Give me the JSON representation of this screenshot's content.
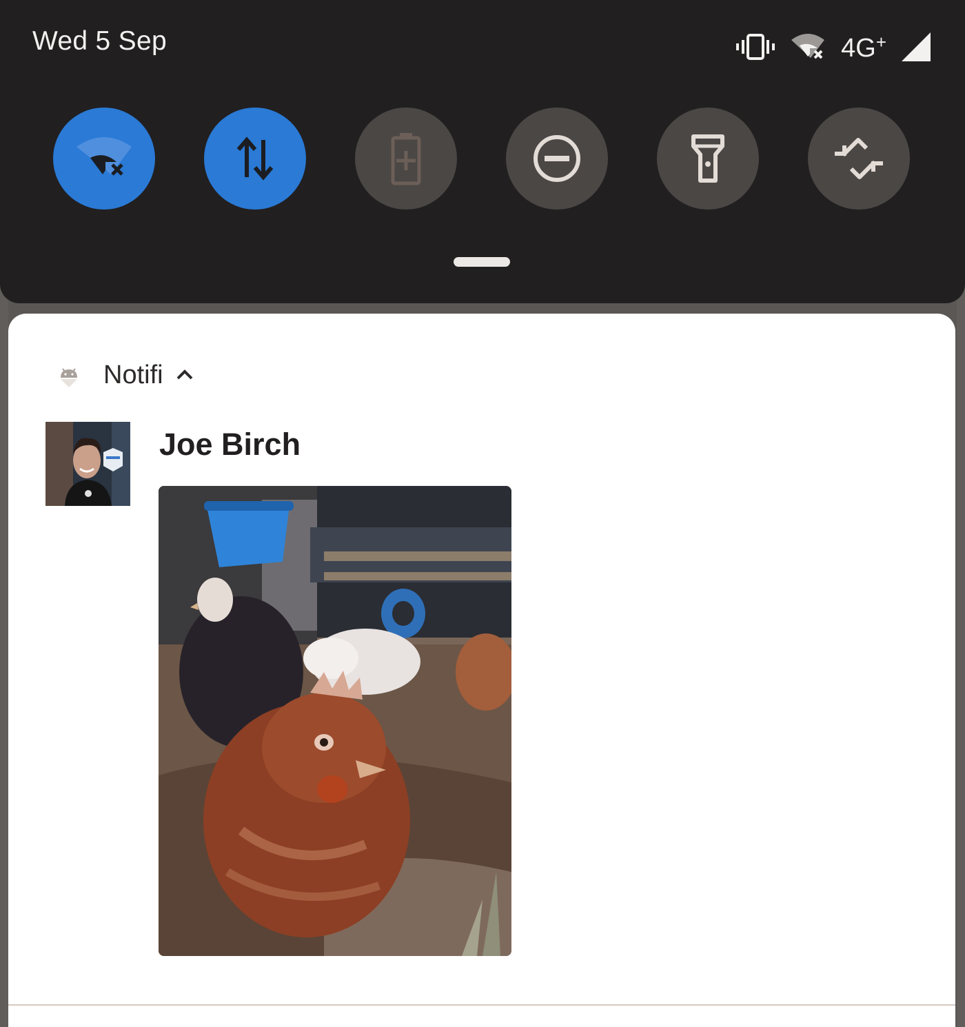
{
  "status_bar": {
    "date": "Wed 5 Sep",
    "network": "4G",
    "network_suffix": "+",
    "icons": [
      "vibrate-icon",
      "wifi-off-icon",
      "cell-signal-icon"
    ]
  },
  "quick_settings": {
    "tiles": [
      {
        "name": "wifi-off-icon",
        "active": true
      },
      {
        "name": "mobile-data-icon",
        "active": true
      },
      {
        "name": "battery-saver-icon",
        "active": false
      },
      {
        "name": "do-not-disturb-icon",
        "active": false
      },
      {
        "name": "flashlight-icon",
        "active": false
      },
      {
        "name": "auto-rotate-icon",
        "active": false
      }
    ]
  },
  "notification": {
    "app_name": "Notifi",
    "sender": "Joe Birch",
    "accent": "#2a7ad6"
  }
}
